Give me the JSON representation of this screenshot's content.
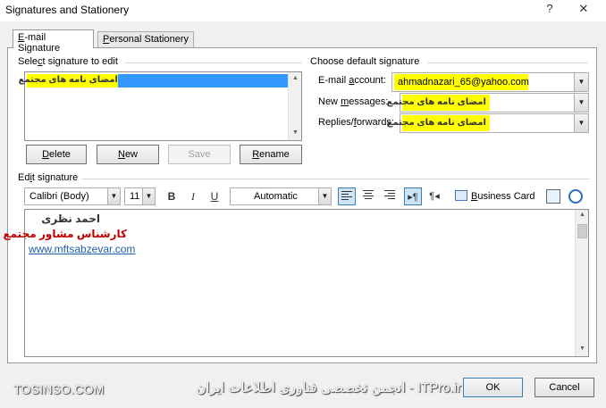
{
  "window": {
    "title": "Signatures and Stationery",
    "help_label": "?",
    "close_label": "✕"
  },
  "tabs": [
    {
      "label_prefix": "",
      "label_underlined": "E",
      "label_rest": "-mail Signature"
    },
    {
      "label_prefix": "",
      "label_underlined": "P",
      "label_rest": "ersonal Stationery"
    }
  ],
  "select_signature": {
    "label_prefix": "Sele",
    "label_underlined": "c",
    "label_rest": "t signature to edit",
    "items": [
      "امضای نامه های مجتمع"
    ],
    "selected_index": 0
  },
  "buttons": {
    "delete": {
      "underlined": "D",
      "rest": "elete"
    },
    "new": {
      "underlined": "N",
      "rest": "ew"
    },
    "save": {
      "label": "Save"
    },
    "rename": {
      "underlined": "R",
      "rest": "ename"
    }
  },
  "default_signature": {
    "group_label": "Choose default signature",
    "email_account": {
      "label_prefix": "E-mail ",
      "label_underlined": "a",
      "label_rest": "ccount:",
      "value": "ahmadnazari_65@yahoo.com"
    },
    "new_messages": {
      "label_prefix": "New ",
      "label_underlined": "m",
      "label_rest": "essages:",
      "value": "امضای نامه های مجتمع"
    },
    "replies_forwards": {
      "label_prefix": "Replies/",
      "label_underlined": "f",
      "label_rest": "orwards:",
      "value": "امضای نامه های مجتمع"
    }
  },
  "edit_signature": {
    "label_prefix": "Ed",
    "label_underlined": "i",
    "label_rest": "t signature",
    "font": "Calibri (Body)",
    "size": "11",
    "bold": "B",
    "italic": "I",
    "underline": "U",
    "color": "Automatic",
    "business_card": {
      "underlined": "B",
      "rest": "usiness Card"
    },
    "content": {
      "line1": "احمد نظری",
      "line2": "کارشناس مشاور مجتمع",
      "line3": "www.mftsabzevar.com"
    },
    "colors": {
      "line2": "#c00000",
      "line3": "#1f5fa8"
    }
  },
  "footer": {
    "watermark_left": "TOSINSO.COM",
    "watermark_right": "ITPro.ir - انجمن تخصصی فناوری اطلاعات ایران",
    "ok_label": "OK",
    "cancel_label": "Cancel"
  }
}
